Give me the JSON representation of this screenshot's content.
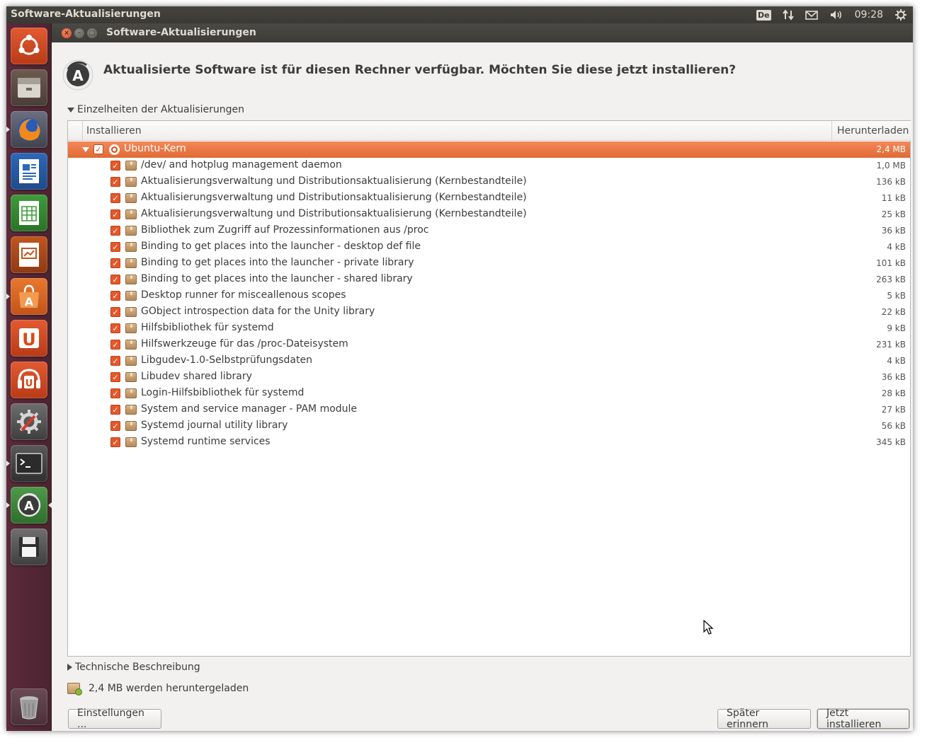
{
  "topbar": {
    "title": "Software-Aktualisierungen",
    "keyboard_layout": "De",
    "clock": "09:28",
    "indicators": [
      "keyboard-layout-icon",
      "network-icon",
      "mail-icon",
      "volume-icon",
      "clock",
      "session-gear-icon"
    ]
  },
  "launcher": {
    "items": [
      "ubuntu-dash-icon",
      "files-icon",
      "firefox-icon",
      "writer-icon",
      "calc-icon",
      "impress-icon",
      "software-center-icon",
      "ubuntu-one-icon",
      "ubuntu-one-music-icon",
      "system-settings-icon",
      "terminal-icon",
      "update-manager-icon",
      "save-icon",
      "trash-icon"
    ]
  },
  "window": {
    "title": "Software-Aktualisierungen",
    "headline": "Aktualisierte Software ist für diesen Rechner verfügbar. Möchten Sie diese jetzt installieren?",
    "details_expander": "Einzelheiten der Aktualisierungen",
    "columns": {
      "install": "Installieren",
      "download": "Herunterladen"
    },
    "group": {
      "name": "Ubuntu-Kern",
      "size": "2,4 MB",
      "checked": true
    },
    "packages": [
      {
        "name": "/dev/ and hotplug management daemon",
        "size": "1,0 MB"
      },
      {
        "name": "Aktualisierungsverwaltung und Distributionsaktualisierung (Kernbestandteile)",
        "size": "136 kB"
      },
      {
        "name": "Aktualisierungsverwaltung und Distributionsaktualisierung (Kernbestandteile)",
        "size": "11 kB"
      },
      {
        "name": "Aktualisierungsverwaltung und Distributionsaktualisierung (Kernbestandteile)",
        "size": "25 kB"
      },
      {
        "name": "Bibliothek zum Zugriff auf Prozessinformationen aus /proc",
        "size": "36 kB"
      },
      {
        "name": "Binding to get places into the launcher - desktop def file",
        "size": "4 kB"
      },
      {
        "name": "Binding to get places into the launcher - private library",
        "size": "101 kB"
      },
      {
        "name": "Binding to get places into the launcher - shared library",
        "size": "263 kB"
      },
      {
        "name": "Desktop runner for misceallenous scopes",
        "size": "5 kB"
      },
      {
        "name": "GObject introspection data for the Unity library",
        "size": "22 kB"
      },
      {
        "name": "Hilfsbibliothek für systemd",
        "size": "9 kB"
      },
      {
        "name": "Hilfswerkzeuge für das /proc-Dateisystem",
        "size": "231 kB"
      },
      {
        "name": "Libgudev-1.0-Selbstprüfungsdaten",
        "size": "4 kB"
      },
      {
        "name": "Libudev shared library",
        "size": "36 kB"
      },
      {
        "name": "Login-Hilfsbibliothek für systemd",
        "size": "28 kB"
      },
      {
        "name": "System and service manager - PAM module",
        "size": "27 kB"
      },
      {
        "name": "Systemd journal utility library",
        "size": "56 kB"
      },
      {
        "name": "Systemd runtime services",
        "size": "345 kB"
      }
    ],
    "tech_expander": "Technische Beschreibung",
    "download_summary": "2,4 MB werden heruntergeladen",
    "buttons": {
      "settings": "Einstellungen ...",
      "remind_later": "Später erinnern",
      "install_now": "Jetzt installieren"
    }
  },
  "colors": {
    "accent": "#e95420",
    "launcher": "#5b2a3a",
    "panel": "#3c3b37"
  }
}
